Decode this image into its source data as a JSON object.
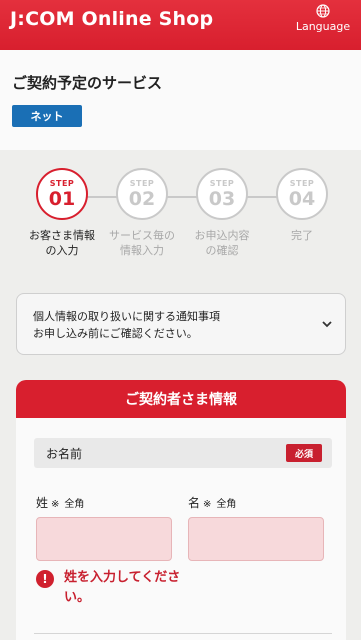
{
  "header": {
    "title": "J:COM Online Shop",
    "language_label": "Language"
  },
  "service": {
    "title": "ご契約予定のサービス",
    "badge": "ネット"
  },
  "steps": [
    {
      "label": "STEP",
      "number": "01",
      "text_line1": "お客さま情報",
      "text_line2": "の入力",
      "active": true
    },
    {
      "label": "STEP",
      "number": "02",
      "text_line1": "サービス毎の",
      "text_line2": "情報入力",
      "active": false
    },
    {
      "label": "STEP",
      "number": "03",
      "text_line1": "お申込内容",
      "text_line2": "の確認",
      "active": false
    },
    {
      "label": "STEP",
      "number": "04",
      "text_line1": "完了",
      "text_line2": "",
      "active": false
    }
  ],
  "notice": {
    "line1": "個人情報の取り扱いに関する通知事項",
    "line2": "お申し込み前にご確認ください。"
  },
  "contractor": {
    "heading": "ご契約者さま情報",
    "name_label": "お名前",
    "required_badge": "必須",
    "last_name": {
      "label": "姓",
      "mark": "※",
      "note": "全角",
      "value": ""
    },
    "first_name": {
      "label": "名",
      "mark": "※",
      "note": "全角",
      "value": ""
    },
    "error_message": "姓を入力してください。"
  },
  "colors": {
    "brand_red": "#d81f2e",
    "badge_blue": "#1a6fb5",
    "field_error_bg": "#f7d9db"
  }
}
